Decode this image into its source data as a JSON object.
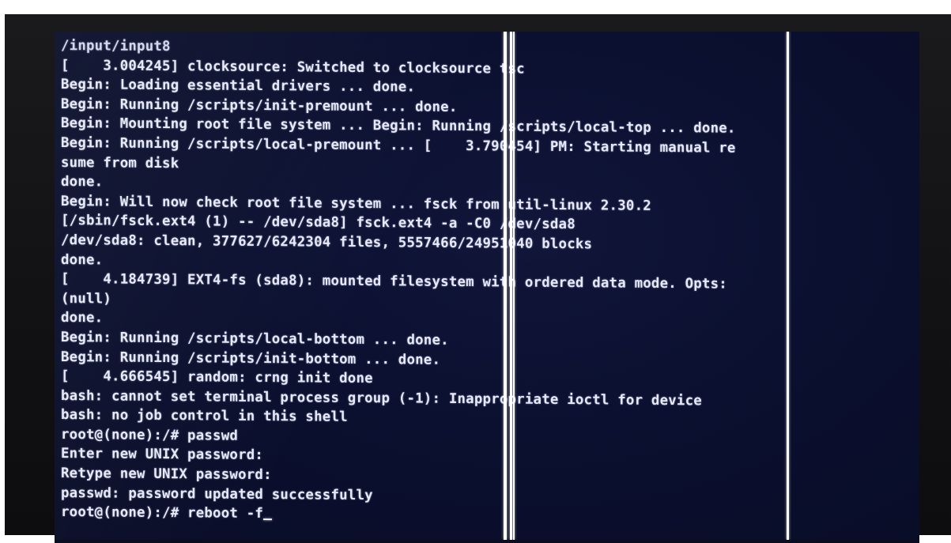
{
  "console": {
    "lines": [
      "/input/input8",
      "[    3.004245] clocksource: Switched to clocksource tsc",
      "Begin: Loading essential drivers ... done.",
      "Begin: Running /scripts/init-premount ... done.",
      "Begin: Mounting root file system ... Begin: Running /scripts/local-top ... done.",
      "Begin: Running /scripts/local-premount ... [    3.790454] PM: Starting manual re",
      "sume from disk",
      "done.",
      "Begin: Will now check root file system ... fsck from util-linux 2.30.2",
      "[/sbin/fsck.ext4 (1) -- /dev/sda8] fsck.ext4 -a -C0 /dev/sda8",
      "/dev/sda8: clean, 377627/6242304 files, 5557466/24951040 blocks",
      "done.",
      "[    4.184739] EXT4-fs (sda8): mounted filesystem with ordered data mode. Opts:",
      "(null)",
      "done.",
      "Begin: Running /scripts/local-bottom ... done.",
      "Begin: Running /scripts/init-bottom ... done.",
      "[    4.666545] random: crng init done",
      "bash: cannot set terminal process group (-1): Inappropriate ioctl for device",
      "bash: no job control in this shell",
      "root@(none):/# passwd",
      "Enter new UNIX password:",
      "Retype new UNIX password:",
      "passwd: password updated successfully",
      "root@(none):/# reboot -f"
    ]
  },
  "colors": {
    "screen_background": "#0b1030",
    "text": "#e7e9f4",
    "bezel": "#121214",
    "stuck_pixel_columns": "#ffffff"
  }
}
